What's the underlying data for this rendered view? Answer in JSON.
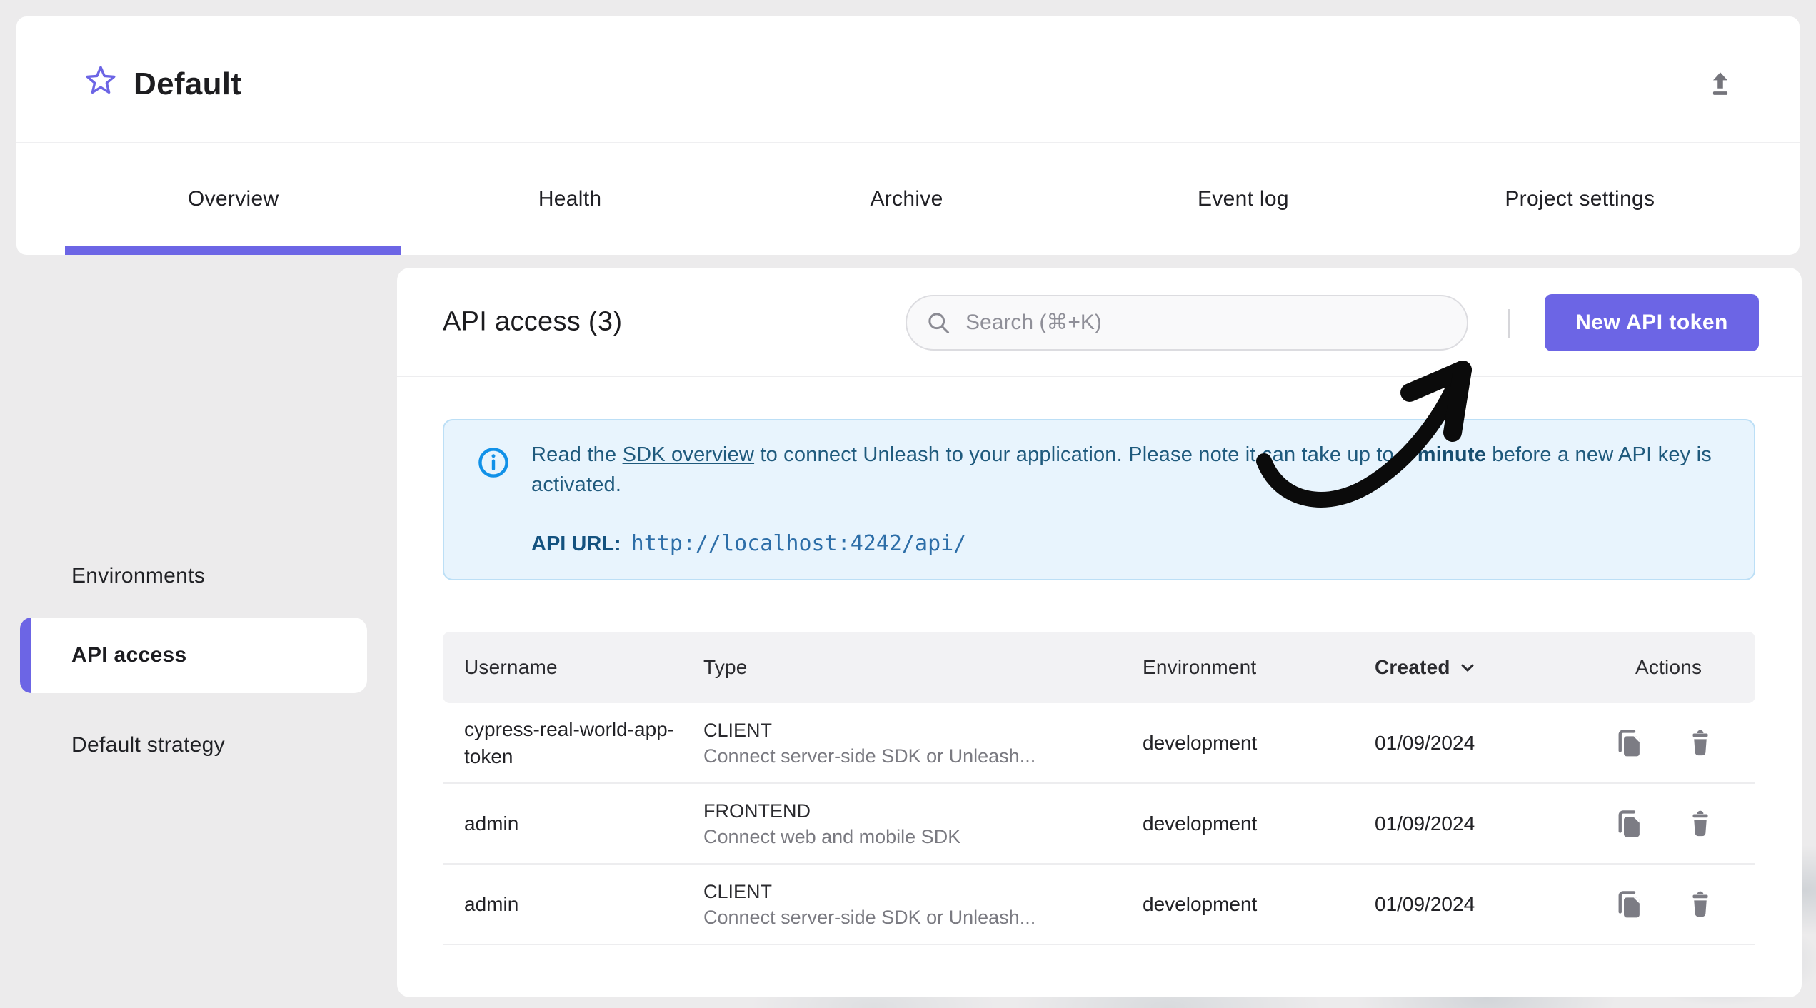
{
  "header": {
    "title": "Default"
  },
  "icons": {
    "favorite": "star-outline",
    "export": "upload-arrow",
    "search": "magnifier",
    "info": "info-circle",
    "sort": "chevron-down",
    "copy": "copy-document",
    "delete": "trash-can"
  },
  "tabs": [
    {
      "label": "Overview",
      "active": true
    },
    {
      "label": "Health",
      "active": false
    },
    {
      "label": "Archive",
      "active": false
    },
    {
      "label": "Event log",
      "active": false
    },
    {
      "label": "Project settings",
      "active": false
    }
  ],
  "sidebar": {
    "items": [
      {
        "label": "Environments",
        "active": false
      },
      {
        "label": "API access",
        "active": true
      },
      {
        "label": "Default strategy",
        "active": false
      }
    ]
  },
  "main": {
    "title": "API access (3)",
    "search": {
      "placeholder": "Search (⌘+K)",
      "value": ""
    },
    "new_token_button": "New API token",
    "alert": {
      "text_before_link": "Read the ",
      "link": "SDK overview",
      "text_middle": " to connect Unleash to your application. Please note it can take up to ",
      "bold": "1 minute",
      "text_end": " before a new API key is activated.",
      "api_url_label": "API URL:",
      "api_url": "http://localhost:4242/api/"
    },
    "table": {
      "columns": [
        "Username",
        "Type",
        "Environment",
        "Created",
        "Actions"
      ],
      "sort": {
        "column": "Created",
        "direction": "desc"
      },
      "rows": [
        {
          "username": "cypress-real-world-app-token",
          "type": "CLIENT",
          "type_description": "Connect server-side SDK or Unleash...",
          "environment": "development",
          "created": "01/09/2024"
        },
        {
          "username": "admin",
          "type": "FRONTEND",
          "type_description": "Connect web and mobile SDK",
          "environment": "development",
          "created": "01/09/2024"
        },
        {
          "username": "admin",
          "type": "CLIENT",
          "type_description": "Connect server-side SDK or Unleash...",
          "environment": "development",
          "created": "01/09/2024"
        }
      ]
    }
  },
  "annotation": {
    "type": "hand-drawn-arrow",
    "points_to": "New API token button"
  },
  "colors": {
    "primary": "#6C65E5",
    "page_background": "#ECEBEC",
    "alert_background": "#E8F4FD",
    "alert_border": "#BCDFF6",
    "alert_text": "#1F5A7D",
    "alert_icon": "#1191E8",
    "api_url_text": "#2D6EA8",
    "icon_gray": "#7C7C84",
    "arrow_ink": "#0B0B0B"
  }
}
